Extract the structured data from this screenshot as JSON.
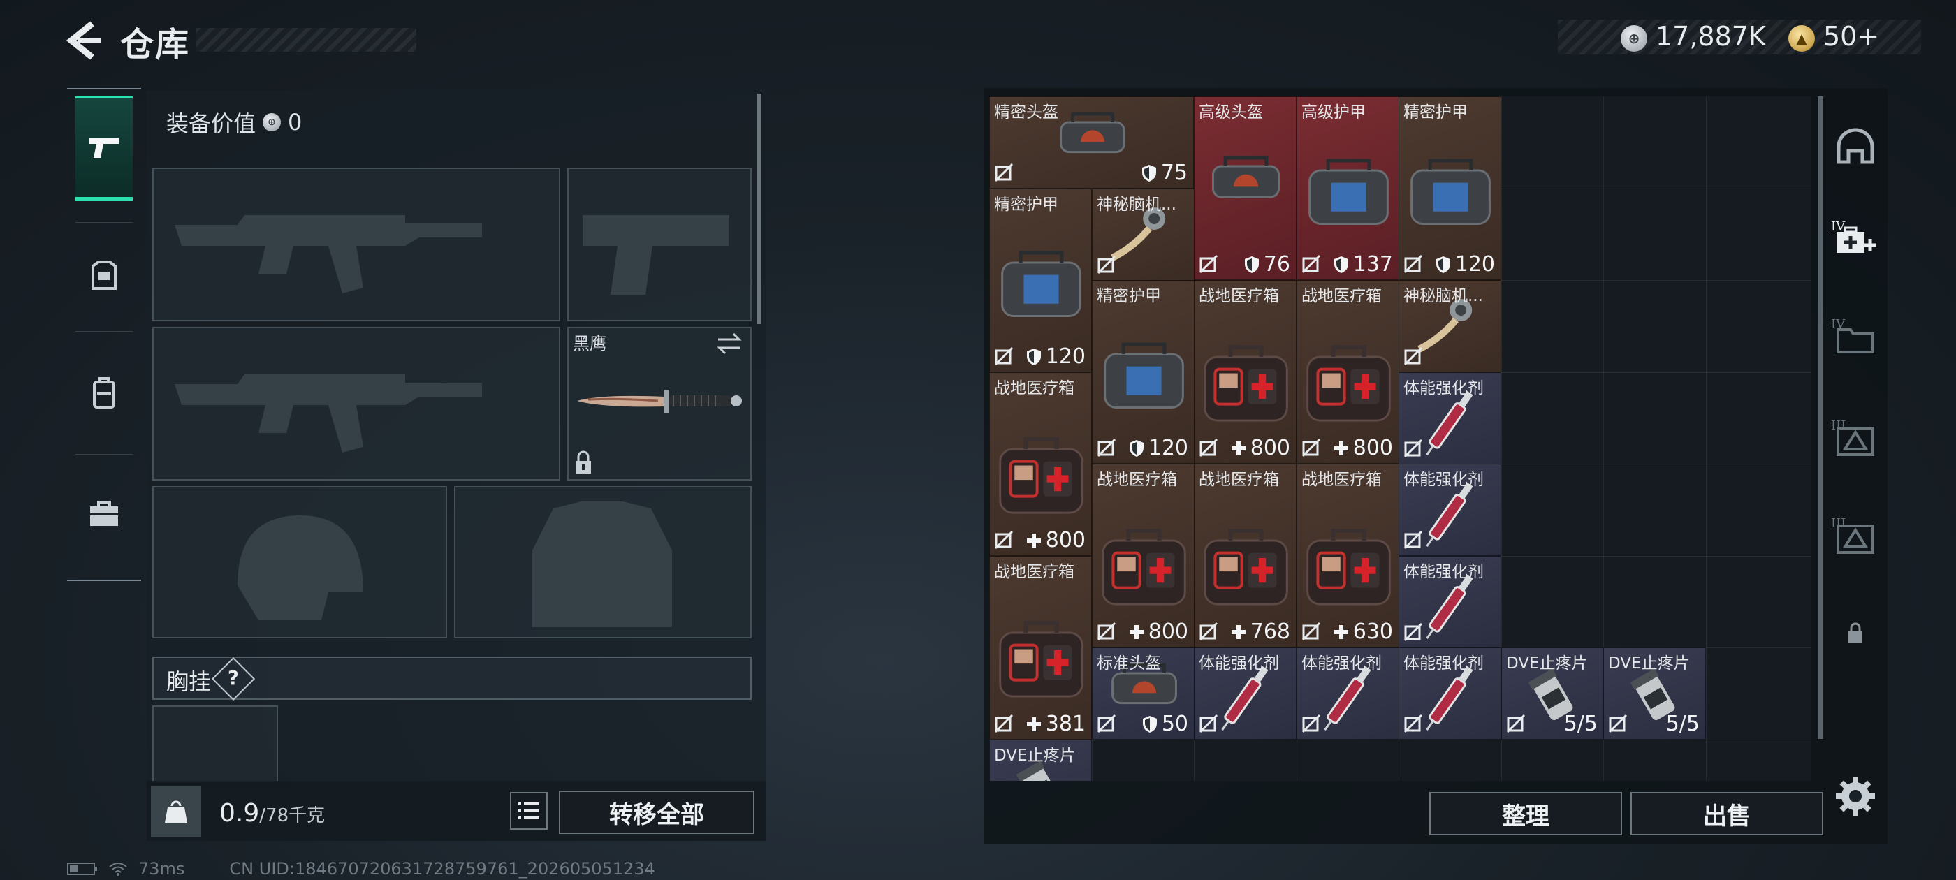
{
  "header": {
    "title": "仓库"
  },
  "currency": {
    "silver": "17,887K",
    "gold": "50+"
  },
  "left_tabs": [
    {
      "name": "weapons",
      "icon": "pistol-icon",
      "active": true
    },
    {
      "name": "armor",
      "icon": "armor-vest-icon",
      "active": false
    },
    {
      "name": "backpack",
      "icon": "backpack-icon",
      "active": false
    },
    {
      "name": "case",
      "icon": "briefcase-icon",
      "active": false
    }
  ],
  "equipment": {
    "value_label": "装备价值",
    "value": "0",
    "knife_name": "黑鹰",
    "chest_label": "胸挂",
    "help": "?"
  },
  "bottom_left": {
    "weight_current": "0.9",
    "weight_max": "/78千克",
    "transfer_all": "转移全部"
  },
  "status": {
    "ping": "73ms",
    "uid": "CN UID:184670720631728759761_202605051234"
  },
  "grid_items": [
    {
      "name": "精密头盔",
      "value": "75",
      "kind": "shield",
      "bg": "brown",
      "icon": "helmet-bag-icon"
    },
    {
      "name": "高级头盔",
      "value": "76",
      "kind": "shield",
      "bg": "red",
      "icon": "helmet-bag-icon"
    },
    {
      "name": "高级护甲",
      "value": "137",
      "kind": "shield",
      "bg": "red",
      "icon": "armor-bag-icon"
    },
    {
      "name": "精密护甲",
      "value": "120",
      "kind": "shield",
      "bg": "brown",
      "icon": "armor-bag-icon"
    },
    {
      "name": "精密护甲",
      "value": "120",
      "kind": "shield",
      "bg": "brown",
      "icon": "armor-bag-icon"
    },
    {
      "name": "神秘脑机...",
      "value": "",
      "kind": "",
      "bg": "brown",
      "icon": "device-icon"
    },
    {
      "name": "精密护甲",
      "value": "120",
      "kind": "shield",
      "bg": "brown",
      "icon": "armor-bag-icon"
    },
    {
      "name": "战地医疗箱",
      "value": "800",
      "kind": "plus",
      "bg": "brown",
      "icon": "medkit-icon"
    },
    {
      "name": "战地医疗箱",
      "value": "800",
      "kind": "plus",
      "bg": "brown",
      "icon": "medkit-icon"
    },
    {
      "name": "神秘脑机...",
      "value": "",
      "kind": "",
      "bg": "brown",
      "icon": "device-icon"
    },
    {
      "name": "战地医疗箱",
      "value": "800",
      "kind": "plus",
      "bg": "brown",
      "icon": "medkit-icon"
    },
    {
      "name": "体能强化剂",
      "value": "",
      "kind": "",
      "bg": "navy",
      "icon": "syringe-icon"
    },
    {
      "name": "战地医疗箱",
      "value": "800",
      "kind": "plus",
      "bg": "brown",
      "icon": "medkit-icon"
    },
    {
      "name": "战地医疗箱",
      "value": "768",
      "kind": "plus",
      "bg": "brown",
      "icon": "medkit-icon"
    },
    {
      "name": "战地医疗箱",
      "value": "630",
      "kind": "plus",
      "bg": "brown",
      "icon": "medkit-icon"
    },
    {
      "name": "体能强化剂",
      "value": "",
      "kind": "",
      "bg": "navy",
      "icon": "syringe-icon"
    },
    {
      "name": "体能强化剂",
      "value": "",
      "kind": "",
      "bg": "navy",
      "icon": "syringe-icon"
    },
    {
      "name": "战地医疗箱",
      "value": "381",
      "kind": "plus",
      "bg": "brown",
      "icon": "medkit-icon"
    },
    {
      "name": "标准头盔",
      "value": "50",
      "kind": "shield",
      "bg": "navy",
      "icon": "helmet-bag-icon"
    },
    {
      "name": "体能强化剂",
      "value": "",
      "kind": "",
      "bg": "navy",
      "icon": "syringe-icon"
    },
    {
      "name": "体能强化剂",
      "value": "",
      "kind": "",
      "bg": "navy",
      "icon": "syringe-icon"
    },
    {
      "name": "体能强化剂",
      "value": "",
      "kind": "",
      "bg": "navy",
      "icon": "syringe-icon"
    },
    {
      "name": "DVE止疼片",
      "value": "5/5",
      "kind": "",
      "bg": "navy",
      "icon": "pill-bottle-icon"
    },
    {
      "name": "DVE止疼片",
      "value": "5/5",
      "kind": "",
      "bg": "navy",
      "icon": "pill-bottle-icon"
    },
    {
      "name": "DVE止疼片",
      "value": "",
      "kind": "",
      "bg": "navy",
      "icon": "pill-bottle-icon"
    }
  ],
  "bottom_right": {
    "sort": "整理",
    "sell": "出售"
  },
  "right_rail": [
    {
      "icon": "helmet-icon",
      "level": ""
    },
    {
      "icon": "medkit-add-icon",
      "level": "IV"
    },
    {
      "icon": "folder-icon",
      "level": "IV"
    },
    {
      "icon": "triangle-case-icon",
      "level": "III"
    },
    {
      "icon": "triangle-case-icon",
      "level": "III"
    },
    {
      "icon": "lock-icon",
      "level": ""
    }
  ]
}
